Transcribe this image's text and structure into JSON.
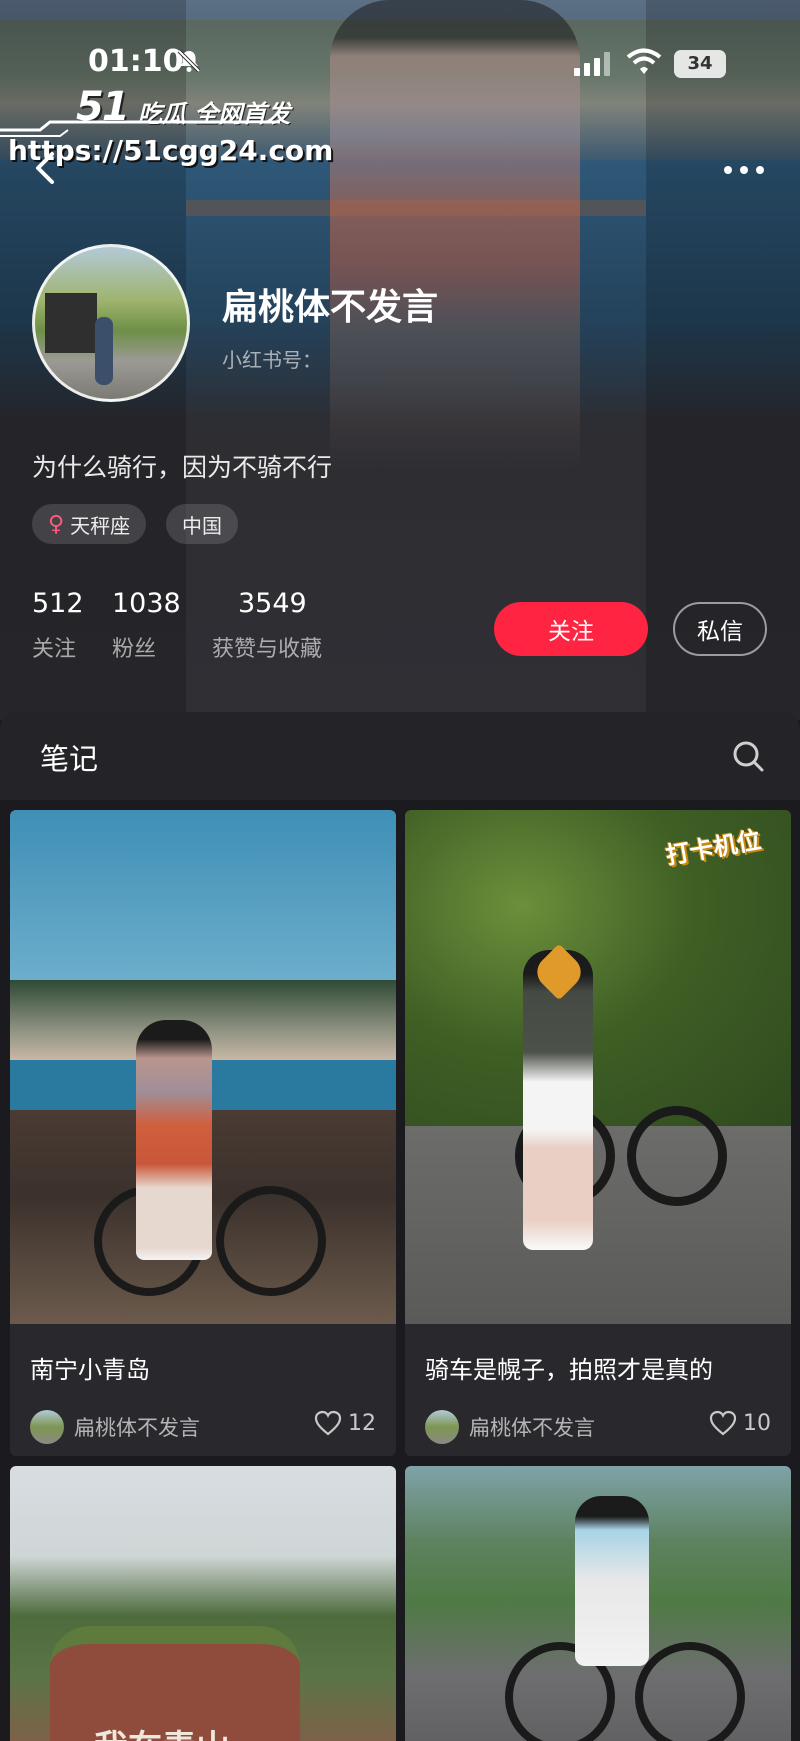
{
  "status_bar": {
    "time": "01:10",
    "battery": "34"
  },
  "watermark": {
    "logo": "51",
    "tagline": "吃瓜 全网首发",
    "url": "https://51cgg24.com"
  },
  "profile": {
    "name": "扁桃体不发言",
    "id_label": "小红书号：",
    "bio": "为什么骑行，因为不骑不行",
    "tags": [
      {
        "icon": "female-icon",
        "label": "天秤座"
      },
      {
        "label": "中国"
      }
    ],
    "stats": [
      {
        "value": "512",
        "label": "关注"
      },
      {
        "value": "1038",
        "label": "粉丝"
      },
      {
        "value": "3549",
        "label": "获赞与收藏"
      }
    ],
    "follow_label": "关注",
    "message_label": "私信"
  },
  "notes": {
    "tab_label": "笔记",
    "cards": [
      {
        "title": "南宁小青岛",
        "author": "扁桃体不发言",
        "likes": "12"
      },
      {
        "title": "骑车是幌子，拍照才是真的",
        "author": "扁桃体不发言",
        "likes": "10",
        "sticker": "打卡机位"
      },
      {
        "overlay_text": "我在青山"
      },
      {}
    ]
  },
  "colors": {
    "accent": "#ff2442",
    "background": "#1b1b1f",
    "panel": "#28282d"
  }
}
